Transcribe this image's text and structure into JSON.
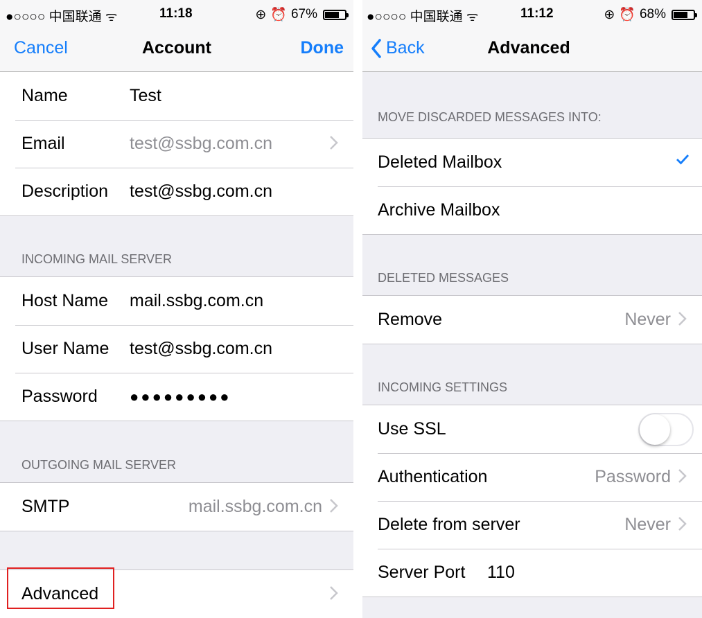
{
  "left": {
    "status": {
      "carrier": "●○○○○ 中国联通 ᯤ",
      "time": "11:18",
      "battery": "67%"
    },
    "nav": {
      "cancel": "Cancel",
      "title": "Account",
      "done": "Done"
    },
    "account_rows": [
      {
        "label": "Name",
        "value": "Test"
      },
      {
        "label": "Email",
        "value": "test@ssbg.com.cn"
      },
      {
        "label": "Description",
        "value": "test@ssbg.com.cn"
      }
    ],
    "incoming_header": "INCOMING MAIL SERVER",
    "incoming_rows": [
      {
        "label": "Host Name",
        "value": "mail.ssbg.com.cn"
      },
      {
        "label": "User Name",
        "value": "test@ssbg.com.cn"
      },
      {
        "label": "Password",
        "value": "●●●●●●●●●"
      }
    ],
    "outgoing_header": "OUTGOING MAIL SERVER",
    "smtp": {
      "label": "SMTP",
      "value": "mail.ssbg.com.cn"
    },
    "advanced": {
      "label": "Advanced"
    }
  },
  "right": {
    "status": {
      "carrier": "●○○○○ 中国联通 ᯤ",
      "time": "11:12",
      "battery": "68%"
    },
    "nav": {
      "back": "Back",
      "title": "Advanced"
    },
    "discard_header": "MOVE DISCARDED MESSAGES INTO:",
    "discard_rows": [
      {
        "label": "Deleted Mailbox",
        "checked": true
      },
      {
        "label": "Archive Mailbox",
        "checked": false
      }
    ],
    "deleted_header": "DELETED MESSAGES",
    "remove": {
      "label": "Remove",
      "value": "Never"
    },
    "incoming_header": "INCOMING SETTINGS",
    "use_ssl": {
      "label": "Use SSL",
      "on": false
    },
    "authentication": {
      "label": "Authentication",
      "value": "Password"
    },
    "delete_from_server": {
      "label": "Delete from server",
      "value": "Never"
    },
    "server_port": {
      "label": "Server Port",
      "value": "110"
    }
  },
  "colors": {
    "accent": "#157efb",
    "highlight": "#e02020",
    "muted": "#8e8e93",
    "background": "#efeff4"
  }
}
